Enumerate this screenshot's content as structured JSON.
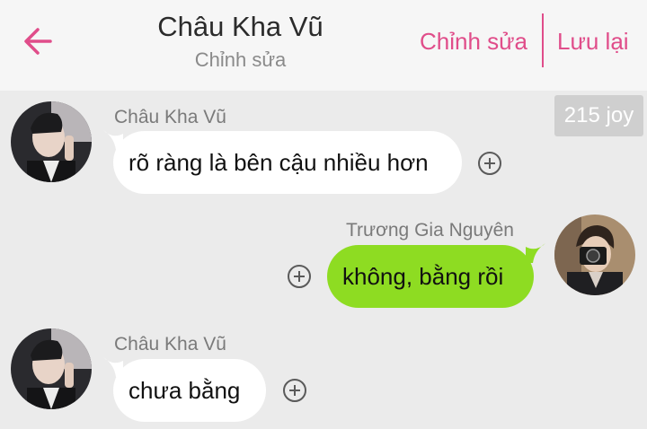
{
  "header": {
    "title": "Châu Kha Vũ",
    "subtitle": "Chỉnh sửa",
    "edit_label": "Chỉnh sửa",
    "save_label": "Lưu lại",
    "back_icon": "arrow-left-icon",
    "accent_color": "#e04d8a"
  },
  "badge": {
    "text": "215 joy"
  },
  "messages": [
    {
      "sender": "Châu Kha Vũ",
      "text": "rõ ràng là bên cậu nhiều hơn",
      "side": "left",
      "bubble_color": "#ffffff"
    },
    {
      "sender": "Trương Gia Nguyên",
      "text": "không, bằng rồi",
      "side": "right",
      "bubble_color": "#8edc22"
    },
    {
      "sender": "Châu Kha Vũ",
      "text": "chưa bằng",
      "side": "left",
      "bubble_color": "#ffffff"
    }
  ],
  "icons": {
    "add": "plus-circle-icon",
    "avatar": "avatar"
  }
}
